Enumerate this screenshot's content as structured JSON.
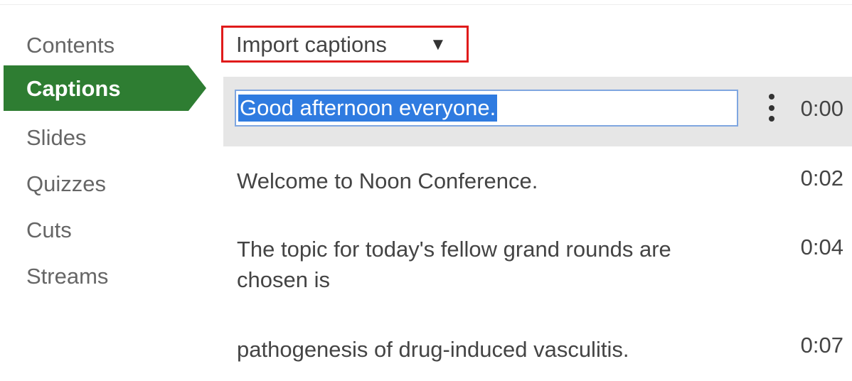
{
  "sidebar": {
    "items": [
      {
        "label": "Contents"
      },
      {
        "label": "Captions"
      },
      {
        "label": "Slides"
      },
      {
        "label": "Quizzes"
      },
      {
        "label": "Cuts"
      },
      {
        "label": "Streams"
      }
    ],
    "active": "Captions"
  },
  "toolbar": {
    "import_label": "Import captions",
    "import_caret_icon": "triangle-down-icon"
  },
  "captions": [
    {
      "text": "Good afternoon everyone.",
      "time": "0:00"
    },
    {
      "text": "Welcome to Noon Conference.",
      "time": "0:02"
    },
    {
      "text": "The topic for today's fellow grand rounds are chosen is",
      "time": "0:04"
    },
    {
      "text": "pathogenesis of drug-induced vasculitis.",
      "time": "0:07"
    }
  ],
  "colors": {
    "active_nav": "#2e7d32",
    "highlight_border": "#e01b1b",
    "selection": "#2f7be0",
    "selected_row": "#e6e6e6"
  }
}
